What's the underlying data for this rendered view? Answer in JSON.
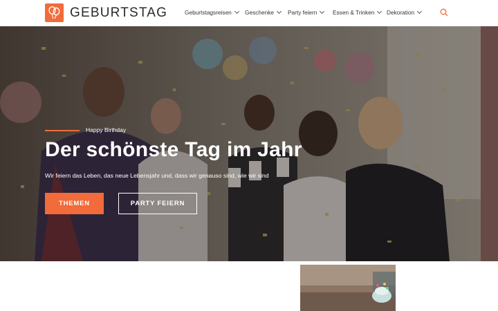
{
  "header": {
    "logo_text": "GEBURTSTAG",
    "nav": [
      {
        "label": "Geburtstagsreisen"
      },
      {
        "label": "Geschenke"
      },
      {
        "label": "Party feiern"
      },
      {
        "label": "Essen & Trinken"
      },
      {
        "label": "Dekoration"
      }
    ],
    "accent_color": "#f26b3a",
    "search_icon": "search-icon"
  },
  "hero": {
    "kicker": "Happy Birthday",
    "title": "Der schönste Tag im Jahr",
    "subtitle": "Wir feiern das Leben, das neue Lebensjahr und, dass wir genauso sind, wie wir sind",
    "buttons": {
      "primary": "THEMEN",
      "secondary": "PARTY FEIERN"
    }
  }
}
